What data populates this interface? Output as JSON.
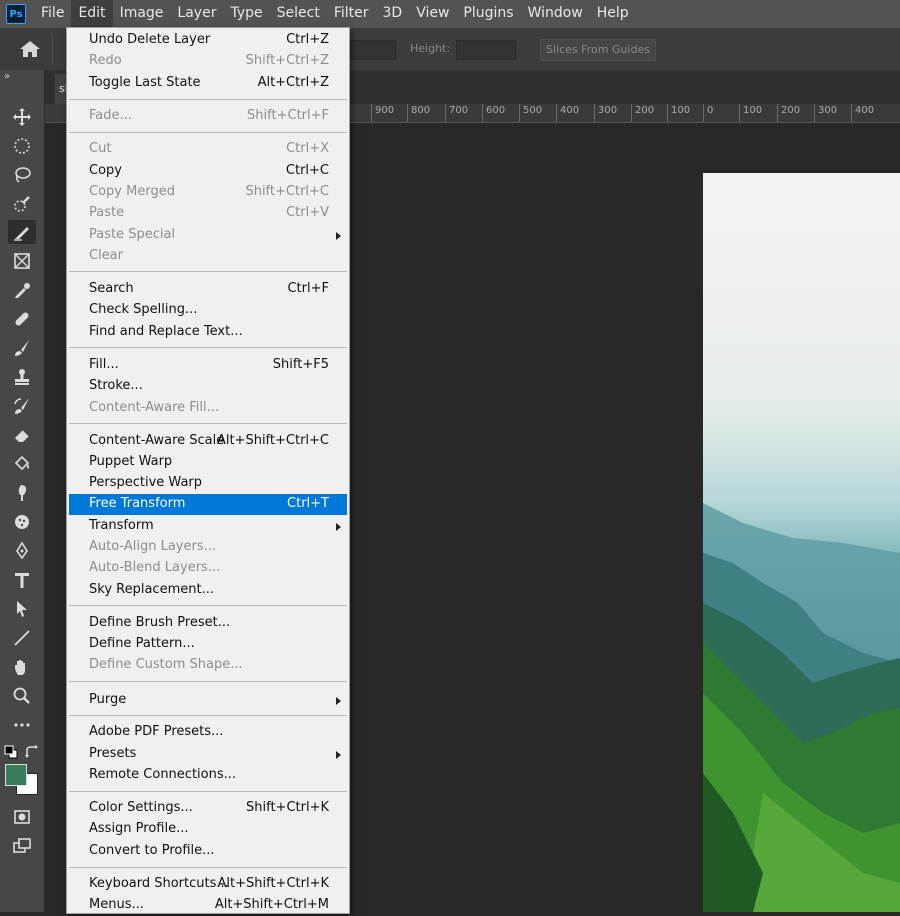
{
  "app": {
    "logo_text": "Ps"
  },
  "menubar": [
    "File",
    "Edit",
    "Image",
    "Layer",
    "Type",
    "Select",
    "Filter",
    "3D",
    "View",
    "Plugins",
    "Window",
    "Help"
  ],
  "options_bar": {
    "height_label": "Height:",
    "slices_button": "Slices From Guides"
  },
  "document_tab": {
    "label": "sl"
  },
  "ruler": {
    "labels": [
      "900",
      "800",
      "700",
      "600",
      "500",
      "400",
      "300",
      "200",
      "100",
      "0",
      "100",
      "200",
      "300",
      "400"
    ]
  },
  "tools": [
    "move-tool",
    "marquee-tool",
    "lasso-tool",
    "quick-select-tool",
    "slice-tool",
    "frame-tool",
    "eyedropper-tool",
    "healing-brush-tool",
    "brush-tool",
    "clone-stamp-tool",
    "history-brush-tool",
    "eraser-tool",
    "paint-bucket-tool",
    "smudge-tool",
    "sponge-tool",
    "pen-tool",
    "type-tool",
    "path-select-tool",
    "line-tool",
    "hand-tool",
    "zoom-tool",
    "more-tools"
  ],
  "colors": {
    "foreground": "#3a7d5c",
    "background": "#ffffff",
    "menu_highlight": "#0078d7"
  },
  "edit_menu": {
    "items": [
      {
        "label": "Undo Delete Layer",
        "shortcut": "Ctrl+Z",
        "enabled": true
      },
      {
        "label": "Redo",
        "shortcut": "Shift+Ctrl+Z",
        "enabled": false
      },
      {
        "label": "Toggle Last State",
        "shortcut": "Alt+Ctrl+Z",
        "enabled": true
      },
      {
        "label": "Fade...",
        "shortcut": "Shift+Ctrl+F",
        "enabled": false
      },
      {
        "label": "Cut",
        "shortcut": "Ctrl+X",
        "enabled": false
      },
      {
        "label": "Copy",
        "shortcut": "Ctrl+C",
        "enabled": true
      },
      {
        "label": "Copy Merged",
        "shortcut": "Shift+Ctrl+C",
        "enabled": false
      },
      {
        "label": "Paste",
        "shortcut": "Ctrl+V",
        "enabled": false
      },
      {
        "label": "Paste Special",
        "shortcut": "",
        "enabled": false,
        "submenu": true
      },
      {
        "label": "Clear",
        "shortcut": "",
        "enabled": false
      },
      {
        "label": "Search",
        "shortcut": "Ctrl+F",
        "enabled": true
      },
      {
        "label": "Check Spelling...",
        "shortcut": "",
        "enabled": true
      },
      {
        "label": "Find and Replace Text...",
        "shortcut": "",
        "enabled": true
      },
      {
        "label": "Fill...",
        "shortcut": "Shift+F5",
        "enabled": true
      },
      {
        "label": "Stroke...",
        "shortcut": "",
        "enabled": true
      },
      {
        "label": "Content-Aware Fill...",
        "shortcut": "",
        "enabled": false
      },
      {
        "label": "Content-Aware Scale",
        "shortcut": "Alt+Shift+Ctrl+C",
        "enabled": true
      },
      {
        "label": "Puppet Warp",
        "shortcut": "",
        "enabled": true
      },
      {
        "label": "Perspective Warp",
        "shortcut": "",
        "enabled": true
      },
      {
        "label": "Free Transform",
        "shortcut": "Ctrl+T",
        "enabled": true,
        "highlighted": true
      },
      {
        "label": "Transform",
        "shortcut": "",
        "enabled": true,
        "submenu": true
      },
      {
        "label": "Auto-Align Layers...",
        "shortcut": "",
        "enabled": false
      },
      {
        "label": "Auto-Blend Layers...",
        "shortcut": "",
        "enabled": false
      },
      {
        "label": "Sky Replacement...",
        "shortcut": "",
        "enabled": true
      },
      {
        "label": "Define Brush Preset...",
        "shortcut": "",
        "enabled": true
      },
      {
        "label": "Define Pattern...",
        "shortcut": "",
        "enabled": true
      },
      {
        "label": "Define Custom Shape...",
        "shortcut": "",
        "enabled": false
      },
      {
        "label": "Purge",
        "shortcut": "",
        "enabled": true,
        "submenu": true
      },
      {
        "label": "Adobe PDF Presets...",
        "shortcut": "",
        "enabled": true
      },
      {
        "label": "Presets",
        "shortcut": "",
        "enabled": true,
        "submenu": true
      },
      {
        "label": "Remote Connections...",
        "shortcut": "",
        "enabled": true
      },
      {
        "label": "Color Settings...",
        "shortcut": "Shift+Ctrl+K",
        "enabled": true
      },
      {
        "label": "Assign Profile...",
        "shortcut": "",
        "enabled": true
      },
      {
        "label": "Convert to Profile...",
        "shortcut": "",
        "enabled": true
      },
      {
        "label": "Keyboard Shortcuts...",
        "shortcut": "Alt+Shift+Ctrl+K",
        "enabled": true
      },
      {
        "label": "Menus...",
        "shortcut": "Alt+Shift+Ctrl+M",
        "enabled": true
      }
    ]
  }
}
